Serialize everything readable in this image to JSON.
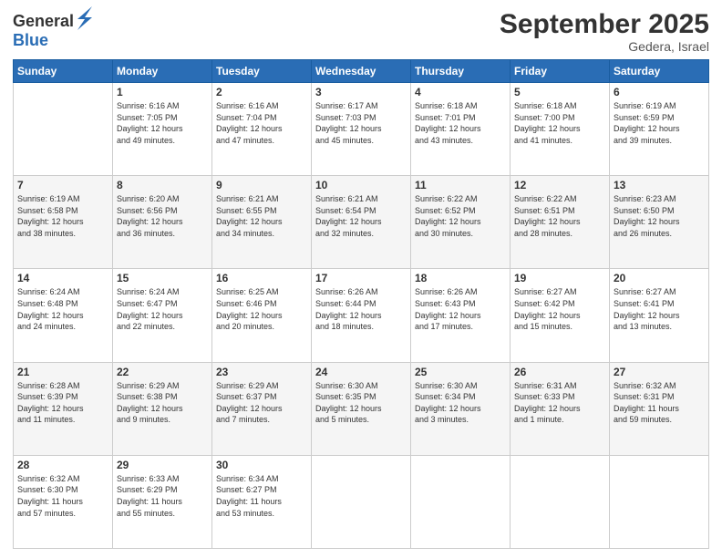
{
  "logo": {
    "general": "General",
    "blue": "Blue"
  },
  "title": "September 2025",
  "location": "Gedera, Israel",
  "days_of_week": [
    "Sunday",
    "Monday",
    "Tuesday",
    "Wednesday",
    "Thursday",
    "Friday",
    "Saturday"
  ],
  "weeks": [
    [
      {
        "day": "",
        "info": ""
      },
      {
        "day": "1",
        "info": "Sunrise: 6:16 AM\nSunset: 7:05 PM\nDaylight: 12 hours\nand 49 minutes."
      },
      {
        "day": "2",
        "info": "Sunrise: 6:16 AM\nSunset: 7:04 PM\nDaylight: 12 hours\nand 47 minutes."
      },
      {
        "day": "3",
        "info": "Sunrise: 6:17 AM\nSunset: 7:03 PM\nDaylight: 12 hours\nand 45 minutes."
      },
      {
        "day": "4",
        "info": "Sunrise: 6:18 AM\nSunset: 7:01 PM\nDaylight: 12 hours\nand 43 minutes."
      },
      {
        "day": "5",
        "info": "Sunrise: 6:18 AM\nSunset: 7:00 PM\nDaylight: 12 hours\nand 41 minutes."
      },
      {
        "day": "6",
        "info": "Sunrise: 6:19 AM\nSunset: 6:59 PM\nDaylight: 12 hours\nand 39 minutes."
      }
    ],
    [
      {
        "day": "7",
        "info": "Sunrise: 6:19 AM\nSunset: 6:58 PM\nDaylight: 12 hours\nand 38 minutes."
      },
      {
        "day": "8",
        "info": "Sunrise: 6:20 AM\nSunset: 6:56 PM\nDaylight: 12 hours\nand 36 minutes."
      },
      {
        "day": "9",
        "info": "Sunrise: 6:21 AM\nSunset: 6:55 PM\nDaylight: 12 hours\nand 34 minutes."
      },
      {
        "day": "10",
        "info": "Sunrise: 6:21 AM\nSunset: 6:54 PM\nDaylight: 12 hours\nand 32 minutes."
      },
      {
        "day": "11",
        "info": "Sunrise: 6:22 AM\nSunset: 6:52 PM\nDaylight: 12 hours\nand 30 minutes."
      },
      {
        "day": "12",
        "info": "Sunrise: 6:22 AM\nSunset: 6:51 PM\nDaylight: 12 hours\nand 28 minutes."
      },
      {
        "day": "13",
        "info": "Sunrise: 6:23 AM\nSunset: 6:50 PM\nDaylight: 12 hours\nand 26 minutes."
      }
    ],
    [
      {
        "day": "14",
        "info": "Sunrise: 6:24 AM\nSunset: 6:48 PM\nDaylight: 12 hours\nand 24 minutes."
      },
      {
        "day": "15",
        "info": "Sunrise: 6:24 AM\nSunset: 6:47 PM\nDaylight: 12 hours\nand 22 minutes."
      },
      {
        "day": "16",
        "info": "Sunrise: 6:25 AM\nSunset: 6:46 PM\nDaylight: 12 hours\nand 20 minutes."
      },
      {
        "day": "17",
        "info": "Sunrise: 6:26 AM\nSunset: 6:44 PM\nDaylight: 12 hours\nand 18 minutes."
      },
      {
        "day": "18",
        "info": "Sunrise: 6:26 AM\nSunset: 6:43 PM\nDaylight: 12 hours\nand 17 minutes."
      },
      {
        "day": "19",
        "info": "Sunrise: 6:27 AM\nSunset: 6:42 PM\nDaylight: 12 hours\nand 15 minutes."
      },
      {
        "day": "20",
        "info": "Sunrise: 6:27 AM\nSunset: 6:41 PM\nDaylight: 12 hours\nand 13 minutes."
      }
    ],
    [
      {
        "day": "21",
        "info": "Sunrise: 6:28 AM\nSunset: 6:39 PM\nDaylight: 12 hours\nand 11 minutes."
      },
      {
        "day": "22",
        "info": "Sunrise: 6:29 AM\nSunset: 6:38 PM\nDaylight: 12 hours\nand 9 minutes."
      },
      {
        "day": "23",
        "info": "Sunrise: 6:29 AM\nSunset: 6:37 PM\nDaylight: 12 hours\nand 7 minutes."
      },
      {
        "day": "24",
        "info": "Sunrise: 6:30 AM\nSunset: 6:35 PM\nDaylight: 12 hours\nand 5 minutes."
      },
      {
        "day": "25",
        "info": "Sunrise: 6:30 AM\nSunset: 6:34 PM\nDaylight: 12 hours\nand 3 minutes."
      },
      {
        "day": "26",
        "info": "Sunrise: 6:31 AM\nSunset: 6:33 PM\nDaylight: 12 hours\nand 1 minute."
      },
      {
        "day": "27",
        "info": "Sunrise: 6:32 AM\nSunset: 6:31 PM\nDaylight: 11 hours\nand 59 minutes."
      }
    ],
    [
      {
        "day": "28",
        "info": "Sunrise: 6:32 AM\nSunset: 6:30 PM\nDaylight: 11 hours\nand 57 minutes."
      },
      {
        "day": "29",
        "info": "Sunrise: 6:33 AM\nSunset: 6:29 PM\nDaylight: 11 hours\nand 55 minutes."
      },
      {
        "day": "30",
        "info": "Sunrise: 6:34 AM\nSunset: 6:27 PM\nDaylight: 11 hours\nand 53 minutes."
      },
      {
        "day": "",
        "info": ""
      },
      {
        "day": "",
        "info": ""
      },
      {
        "day": "",
        "info": ""
      },
      {
        "day": "",
        "info": ""
      }
    ]
  ]
}
